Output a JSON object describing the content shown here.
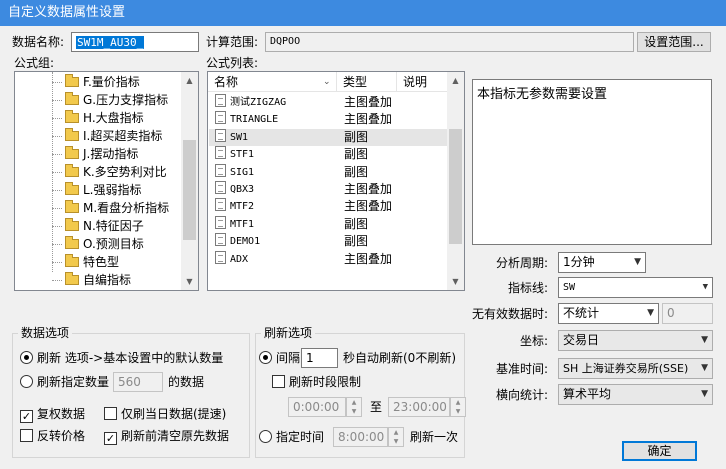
{
  "window": {
    "title": "自定义数据属性设置"
  },
  "data_name": {
    "label": "数据名称:",
    "value": "SW1M_AU30_"
  },
  "calc_range": {
    "label": "计算范围:",
    "value": "DQPOO",
    "button": "设置范围..."
  },
  "formula_group": {
    "label": "公式组:",
    "items": [
      "F.量价指标",
      "G.压力支撑指标",
      "H.大盘指标",
      "I.超买超卖指标",
      "J.摆动指标",
      "K.多空势利对比",
      "L.强弱指标",
      "M.看盘分析指标",
      "N.特征因子",
      "O.预测目标",
      "特色型",
      "自编指标"
    ]
  },
  "formula_list": {
    "label": "公式列表:",
    "columns": [
      "名称",
      "类型",
      "说明"
    ],
    "rows": [
      {
        "name": "测试ZIGZAG",
        "type": "主图叠加"
      },
      {
        "name": "TRIANGLE",
        "type": "主图叠加"
      },
      {
        "name": "SW1",
        "type": "副图"
      },
      {
        "name": "STF1",
        "type": "副图"
      },
      {
        "name": "SIG1",
        "type": "副图"
      },
      {
        "name": "QBX3",
        "type": "主图叠加"
      },
      {
        "name": "MTF2",
        "type": "主图叠加"
      },
      {
        "name": "MTF1",
        "type": "副图"
      },
      {
        "name": "DEMO1",
        "type": "副图"
      },
      {
        "name": "ADX",
        "type": "主图叠加"
      }
    ]
  },
  "description": "本指标无参数需要设置",
  "settings": {
    "period": {
      "label": "分析周期:",
      "value": "1分钟"
    },
    "indicator_line": {
      "label": "指标线:",
      "value": "SW"
    },
    "invalid_data": {
      "label": "无有效数据时:",
      "value": "不统计",
      "num": "0"
    },
    "axis": {
      "label": "坐标:",
      "value": "交易日"
    },
    "base_time": {
      "label": "基准时间:",
      "value": "SH 上海证券交易所(SSE)"
    },
    "horizontal_stat": {
      "label": "横向统计:",
      "value": "算术平均"
    }
  },
  "data_options": {
    "title": "数据选项",
    "refresh_option": "刷新 选项->基本设置中的默认数量",
    "refresh_count_label": "刷新指定数量",
    "refresh_count_value": "560",
    "refresh_count_suffix": "的数据",
    "restore_rights": "复权数据",
    "only_today": "仅刷当日数据(提速)",
    "reverse_price": "反转价格",
    "clear_before": "刷新前清空原先数据"
  },
  "refresh_options": {
    "title": "刷新选项",
    "interval_label": "间隔",
    "interval_value": "1",
    "interval_suffix": "秒自动刷新(0不刷新)",
    "time_limit": "刷新时段限制",
    "time_from": "0:00:00",
    "time_to_label": "至",
    "time_to": "23:00:00",
    "fixed_time_label": "指定时间",
    "fixed_time_value": "8:00:00",
    "fixed_time_suffix": "刷新一次"
  },
  "ok_button": "确定"
}
